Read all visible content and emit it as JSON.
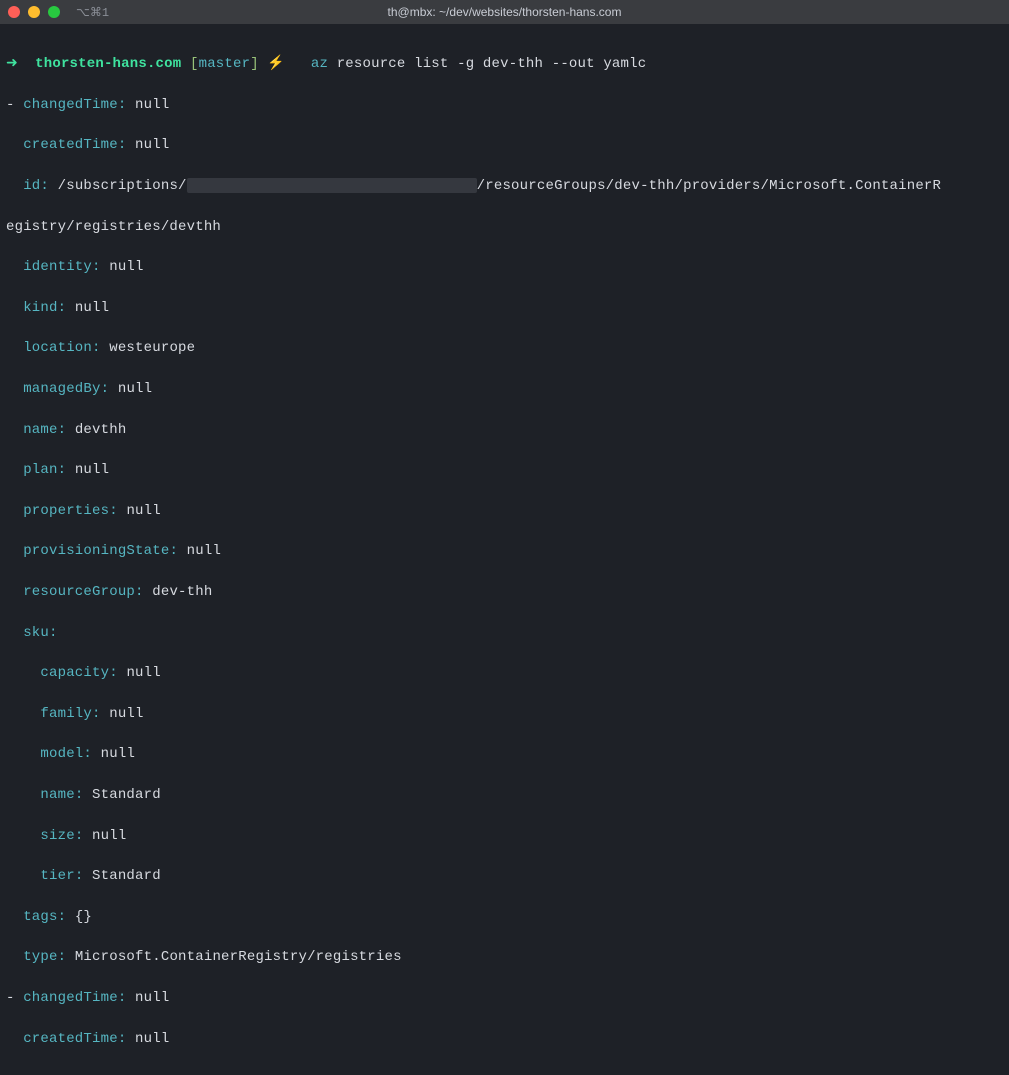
{
  "titlebar": {
    "tab_indicator": "⌥⌘1",
    "title": "th@mbx: ~/dev/websites/thorsten-hans.com"
  },
  "prompt": {
    "arrow": "➜",
    "host": "thorsten-hans.com",
    "branch_open": "[",
    "branch": "master",
    "branch_close": "]",
    "lightning": "⚡",
    "cmd_first": "az",
    "cmd_rest": "resource list -g dev-thh --out yamlc"
  },
  "output": {
    "item1": {
      "changedTime": "null",
      "createdTime": "null",
      "id_prefix": "/subscriptions/",
      "id_suffix_line1": "/resourceGroups/dev-thh/providers/Microsoft.ContainerR",
      "id_suffix_line2": "egistry/registries/devthh",
      "identity": "null",
      "kind": "null",
      "location": "westeurope",
      "managedBy": "null",
      "name": "devthh",
      "plan": "null",
      "properties": "null",
      "provisioningState": "null",
      "resourceGroup": "dev-thh",
      "sku": {
        "capacity": "null",
        "family": "null",
        "model": "null",
        "name": "Standard",
        "size": "null",
        "tier": "Standard"
      },
      "tags": "{}",
      "type": "Microsoft.ContainerRegistry/registries"
    },
    "item2": {
      "changedTime": "null",
      "createdTime": "null"
    },
    "keys": {
      "changedTime": "changedTime",
      "createdTime": "createdTime",
      "id": "id",
      "identity": "identity",
      "kind": "kind",
      "location": "location",
      "managedBy": "managedBy",
      "name": "name",
      "plan": "plan",
      "properties": "properties",
      "provisioningState": "provisioningState",
      "resourceGroup": "resourceGroup",
      "sku": "sku",
      "capacity": "capacity",
      "family": "family",
      "model": "model",
      "size": "size",
      "tier": "tier",
      "tags": "tags",
      "type": "type"
    }
  }
}
